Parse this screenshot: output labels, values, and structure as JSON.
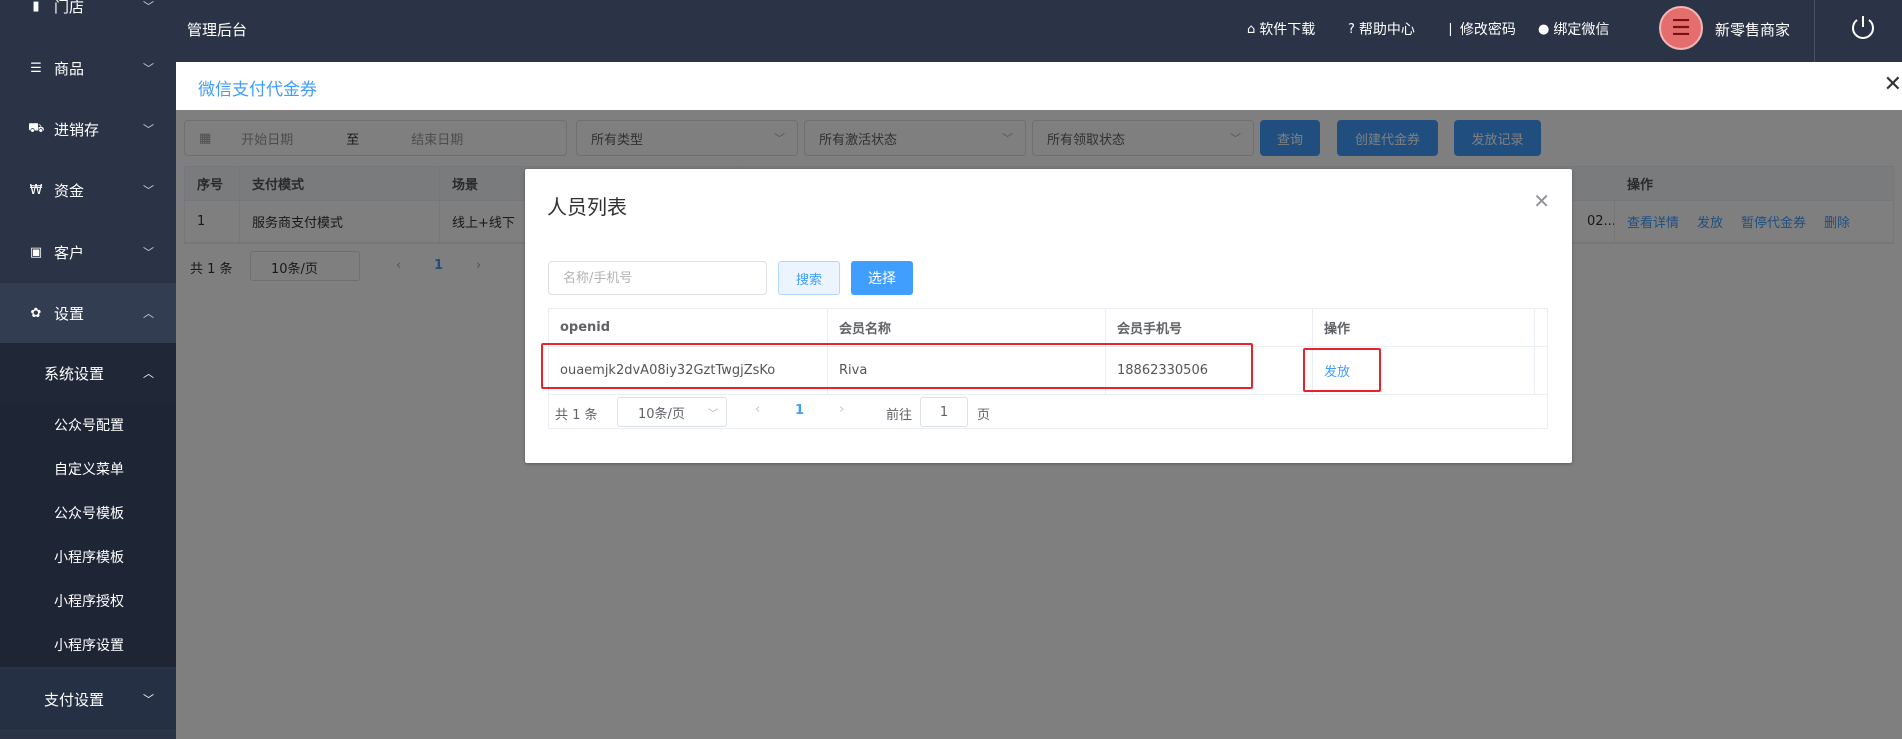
{
  "sidebar": {
    "items": [
      {
        "label": "门店",
        "icon": "store-icon"
      },
      {
        "label": "商品",
        "icon": "list-icon"
      },
      {
        "label": "进销存",
        "icon": "truck-icon"
      },
      {
        "label": "资金",
        "icon": "won-icon"
      },
      {
        "label": "客户",
        "icon": "id-card-icon"
      },
      {
        "label": "设置",
        "icon": "gear-icon"
      }
    ],
    "sub_group": "系统设置",
    "leaves": [
      "公众号配置",
      "自定义菜单",
      "公众号模板",
      "小程序模板",
      "小程序授权",
      "小程序设置"
    ],
    "bottom": "支付设置"
  },
  "topbar": {
    "title": "管理后台",
    "links": [
      {
        "label": "软件下载",
        "icon": "download-icon"
      },
      {
        "label": "帮助中心",
        "icon": "help-icon"
      },
      {
        "label": "修改密码",
        "icon": "thermometer-icon"
      },
      {
        "label": "绑定微信",
        "icon": "wechat-icon"
      }
    ],
    "shop_name": "新零售商家"
  },
  "panel": {
    "title": "微信支付代金券"
  },
  "filters": {
    "start_date": "开始日期",
    "to": "至",
    "end_date": "结束日期",
    "type": "所有类型",
    "activation": "所有激活状态",
    "receive": "所有领取状态",
    "query": "查询",
    "create": "创建代金券",
    "records": "发放记录"
  },
  "bg_table": {
    "headers": [
      "序号",
      "支付模式",
      "场景",
      "操作"
    ],
    "row": {
      "index": "1",
      "mode": "服务商支付模式",
      "scene": "线上+线下",
      "truncated": "02...",
      "actions": [
        "查看详情",
        "发放",
        "暂停代金券",
        "删除"
      ]
    },
    "pager": {
      "total": "共 1 条",
      "size": "10条/页",
      "page": "1"
    }
  },
  "dialog": {
    "title": "人员列表",
    "search_placeholder": "名称/手机号",
    "search_btn": "搜索",
    "select_btn": "选择",
    "headers": [
      "openid",
      "会员名称",
      "会员手机号",
      "操作"
    ],
    "rows": [
      {
        "openid": "ouaemjk2dvA08iy32GztTwgjZsKo",
        "name": "Riva",
        "phone": "18862330506",
        "action": "发放"
      }
    ],
    "pager": {
      "total": "共 1 条",
      "size": "10条/页",
      "page": "1",
      "goto": "前往",
      "goto_value": "1",
      "page_suffix": "页"
    }
  },
  "colors": {
    "accent": "#409eff",
    "sidebar": "#2b3446",
    "highlight": "#e8232b"
  }
}
